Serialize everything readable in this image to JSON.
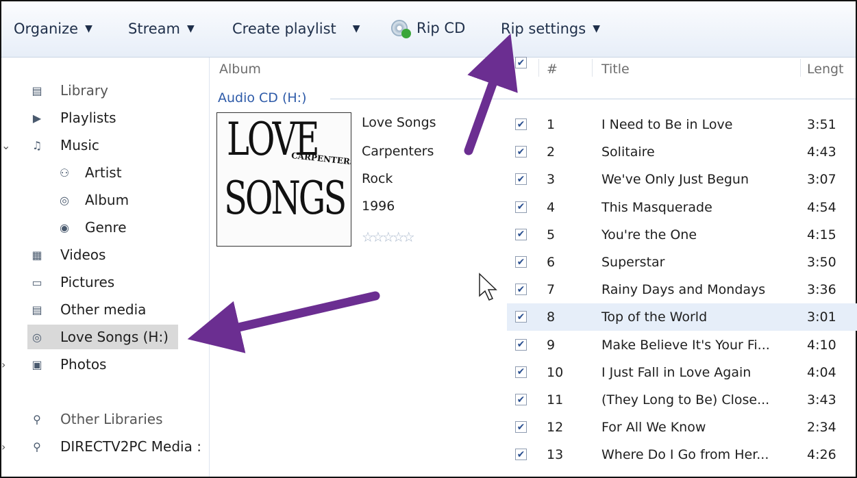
{
  "toolbar": {
    "organize": "Organize",
    "stream": "Stream",
    "create_playlist": "Create playlist",
    "rip_cd": "Rip CD",
    "rip_settings": "Rip settings"
  },
  "nav": {
    "library": "Library",
    "playlists": "Playlists",
    "music": "Music",
    "artist": "Artist",
    "album": "Album",
    "genre": "Genre",
    "videos": "Videos",
    "pictures": "Pictures",
    "other_media": "Other media",
    "love_songs": "Love Songs (H:)",
    "photos": "Photos",
    "other_libraries": "Other Libraries",
    "directv": "DIRECTV2PC Media :"
  },
  "columns": {
    "album": "Album",
    "number": "#",
    "title": "Title",
    "length": "Lengt"
  },
  "group": {
    "title": "Audio CD (H:)"
  },
  "album_art": {
    "line1": "LOVE",
    "line2": "SONGS",
    "brand": "CARPENTERS"
  },
  "album_info": {
    "name": "Love Songs",
    "artist": "Carpenters",
    "genre": "Rock",
    "year": "1996",
    "rating": "☆☆☆☆☆"
  },
  "tracks": [
    {
      "num": "1",
      "title": "I Need to Be in Love",
      "length": "3:51"
    },
    {
      "num": "2",
      "title": "Solitaire",
      "length": "4:43"
    },
    {
      "num": "3",
      "title": "We've Only Just Begun",
      "length": "3:07"
    },
    {
      "num": "4",
      "title": "This Masquerade",
      "length": "4:54"
    },
    {
      "num": "5",
      "title": "You're the One",
      "length": "4:15"
    },
    {
      "num": "6",
      "title": "Superstar",
      "length": "3:50"
    },
    {
      "num": "7",
      "title": "Rainy Days and Mondays",
      "length": "3:36"
    },
    {
      "num": "8",
      "title": "Top of the World",
      "length": "3:01"
    },
    {
      "num": "9",
      "title": "Make Believe It's Your Fi...",
      "length": "4:10"
    },
    {
      "num": "10",
      "title": "I Just Fall in Love Again",
      "length": "4:04"
    },
    {
      "num": "11",
      "title": "(They Long to Be) Close...",
      "length": "3:43"
    },
    {
      "num": "12",
      "title": "For All We Know",
      "length": "2:34"
    },
    {
      "num": "13",
      "title": "Where Do I Go from Her...",
      "length": "4:26"
    }
  ],
  "highlighted_track": 8,
  "colors": {
    "annotation_arrow": "#6b2e91",
    "link_blue": "#2d5aa8",
    "selection_gray": "#d9d9d9"
  }
}
